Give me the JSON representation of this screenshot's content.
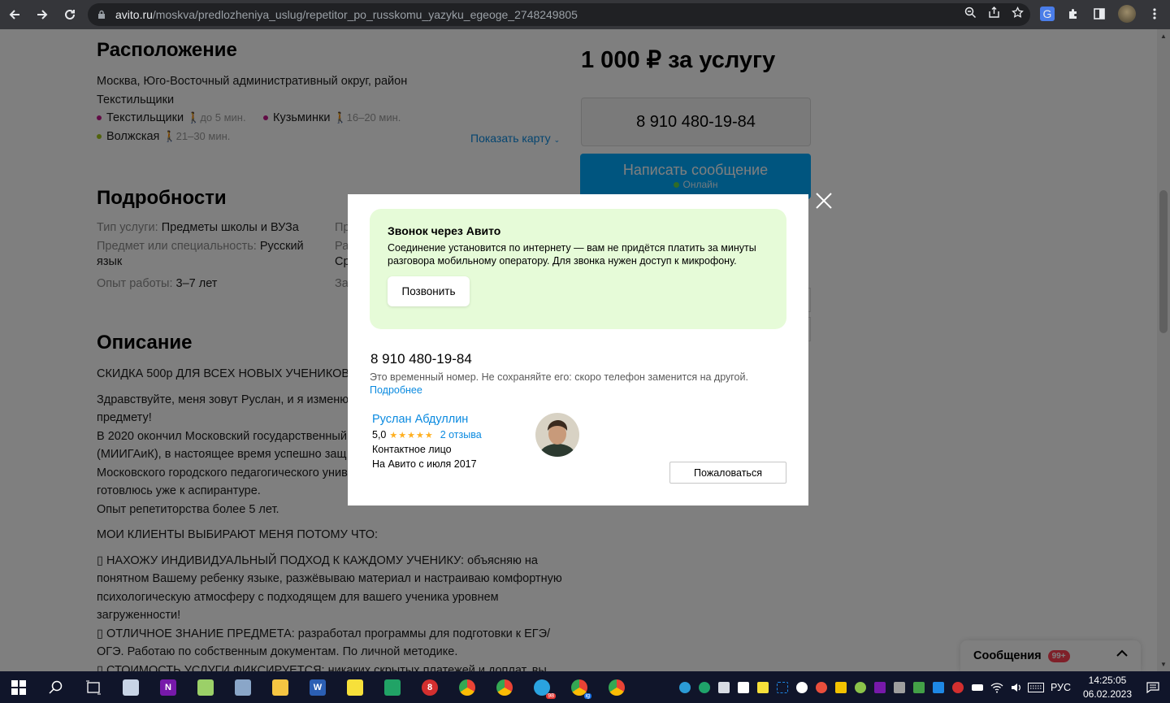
{
  "browser": {
    "url_host": "avito.ru",
    "url_path": "/moskva/predlozheniya_uslug/repetitor_po_russkomu_yazyku_egeoge_2748249805"
  },
  "location": {
    "heading": "Расположение",
    "address_line1": "Москва, Юго-Восточный административный округ, район",
    "address_line2": "Текстильщики",
    "metro": [
      {
        "name": "Текстильщики",
        "time": "до 5 мин.",
        "color": "#c2188b"
      },
      {
        "name": "Кузьминки",
        "time": "16–20 мин.",
        "color": "#c2188b"
      },
      {
        "name": "Волжская",
        "time": "21–30 мин.",
        "color": "#a5c61a"
      }
    ],
    "show_map": "Показать карту"
  },
  "details": {
    "heading": "Подробности",
    "rows": [
      {
        "label": "Тип услуги:",
        "value": "Предметы школы и ВУЗа"
      },
      {
        "label": "Предмет или специальность:",
        "value": "Русский"
      },
      {
        "label": "",
        "value": "язык"
      },
      {
        "label": "Опыт работы:",
        "value": "3–7 лет"
      }
    ],
    "col2_fragments": [
      "Пр",
      "Ра",
      "Ср",
      "За"
    ]
  },
  "description": {
    "heading": "Описание",
    "lines": [
      "СКИДКА 500р ДЛЯ ВСЕХ НОВЫХ УЧЕНИКОВ",
      "Здравствуйте, меня зовут Руслан, и я изменю",
      "предмету!",
      "В 2020 окончил Московский государственный",
      "(МИИГАиК), в настоящее время успешно защ",
      "Московского городского педагогического униве",
      "готовлюсь уже к аспирантуре.",
      "Опыт репетиторства более 5 лет.",
      "МОИ КЛИЕНТЫ ВЫБИРАЮТ МЕНЯ ПОТОМУ ЧТО:",
      "▯ НАХОЖУ ИНДИВИДУАЛЬНЫЙ ПОДХОД К КАЖДОМУ УЧЕНИКУ: объясняю на",
      "понятном Вашему ребенку языке, разжёвываю материал и настраиваю комфортную",
      "психологическую атмосферу с подходящем для вашего ученика уровнем",
      "загруженности!",
      "▯ ОТЛИЧНОЕ ЗНАНИЕ ПРЕДМЕТА: разработал программы для подготовки к ЕГЭ/",
      "ОГЭ. Работаю по собственным документам. По личной методике.",
      "▯ СТОИМОСТЬ УСЛУГИ ФИКСИРУЕТСЯ: никаких скрытых платежей и доплат, вы"
    ]
  },
  "sidebar": {
    "price": "1 000 ₽ за услугу",
    "phone": "8 910 480-19-84",
    "message_button": "Написать сообщение",
    "online": "Онлайн"
  },
  "messages_bar": {
    "label": "Сообщения",
    "badge": "99+"
  },
  "modal": {
    "card_title": "Звонок через Авито",
    "card_text": "Соединение установится по интернету — вам не придётся платить за минуты разговора мобильному оператору. Для звонка нужен доступ к микрофону.",
    "call_button": "Позвонить",
    "phone": "8 910 480-19-84",
    "note": "Это временный номер. Не сохраняйте его: скоро телефон заменится на другой.",
    "more_link": "Подробнее",
    "seller_name": "Руслан Абдуллин",
    "rating": "5,0",
    "stars": "★★★★★",
    "reviews": "2 отзыва",
    "contact_role": "Контактное лицо",
    "since": "На Авито с июля 2017",
    "report_button": "Пожаловаться"
  },
  "taskbar": {
    "lang": "РУС",
    "time": "14:25:05",
    "date": "06.02.2023",
    "telegram_badge": "98",
    "chrome_badge": "ig"
  }
}
